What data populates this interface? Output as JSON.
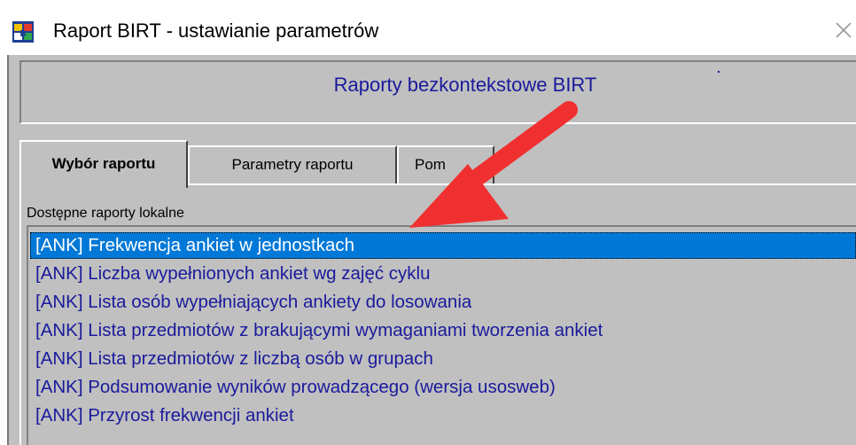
{
  "window": {
    "title": "Raport BIRT - ustawianie parametrów"
  },
  "header": {
    "title": "Raporty bezkontekstowe BIRT"
  },
  "tabs": [
    {
      "label": "Wybór raportu",
      "active": true
    },
    {
      "label": "Parametry raportu",
      "active": false
    },
    {
      "label": "Pom",
      "active": false
    }
  ],
  "report_list": {
    "label": "Dostępne raporty lokalne",
    "items": [
      {
        "label": "[ANK] Frekwencja ankiet w jednostkach",
        "selected": true
      },
      {
        "label": "[ANK] Liczba wypełnionych ankiet wg zajęć cyklu",
        "selected": false
      },
      {
        "label": "[ANK] Lista osób wypełniających ankiety do losowania",
        "selected": false
      },
      {
        "label": "[ANK] Lista przedmiotów z brakującymi wymaganiami tworzenia ankiet",
        "selected": false
      },
      {
        "label": "[ANK] Lista przedmiotów z liczbą osób w grupach",
        "selected": false
      },
      {
        "label": "[ANK] Podsumowanie wyników prowadzącego (wersja usosweb)",
        "selected": false
      },
      {
        "label": "[ANK] Przyrost frekwencji ankiet",
        "selected": false
      }
    ]
  },
  "colors": {
    "face": "#c0c0c0",
    "text_blue": "#1a1a9c",
    "selection": "#0078d7",
    "annotation_arrow": "#f03030"
  },
  "icons": {
    "app": "birt-app-icon",
    "close": "close-icon",
    "annotation": "red-arrow-icon"
  }
}
